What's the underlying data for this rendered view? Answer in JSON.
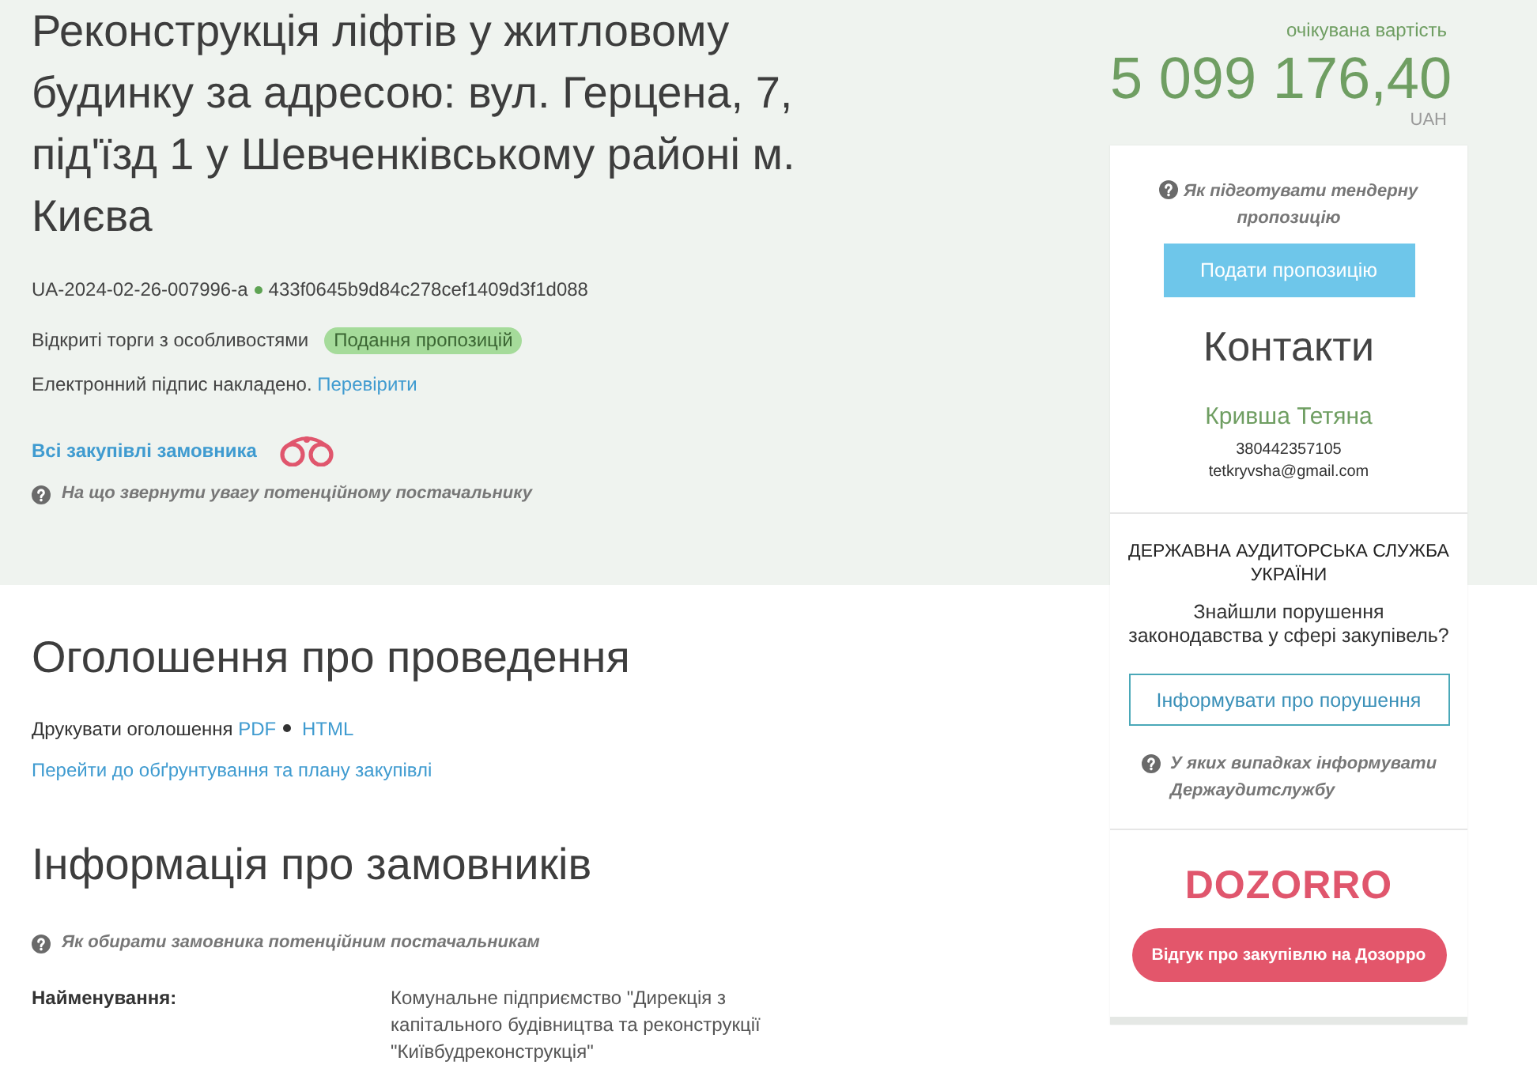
{
  "tender": {
    "title": "Реконструкція ліфтів у житловому будинку за адресою: вул. Герцена, 7, під'їзд 1 у Шевченківському районі м. Києва",
    "id": "UA-2024-02-26-007996-a",
    "hash": "433f0645b9d84c278cef1409d3f1d088",
    "procedure": "Відкриті торги з особливостями",
    "status_badge": "Подання пропозицій",
    "signature_text": "Електронний підпис накладено.",
    "signature_link": "Перевірити",
    "buyer_link": "Всі закупівлі замовника",
    "help_link": "На що звернути увагу потенційному постачальнику"
  },
  "value": {
    "label": "очікувана вартість",
    "amount": "5 099 176,40",
    "currency": "UAH"
  },
  "sidebar": {
    "help_link": "Як підготувати тендерну пропозицію",
    "submit_button": "Подати пропозицію",
    "contacts": {
      "title": "Контакти",
      "name": "Кривша Тетяна",
      "phone": "380442357105",
      "email": "tetkryvsha@gmail.com"
    },
    "audit": {
      "title": "ДЕРЖАВНА АУДИТОРСЬКА СЛУЖБА УКРАЇНИ",
      "question": "Знайшли порушення законодавства у сфері закупівель?",
      "report_button": "Інформувати про порушення",
      "help_link": "У яких випадках інформувати Держаудитслужбу"
    },
    "dozorro": {
      "logo": "DOZORRO",
      "feedback_button": "Відгук про закупівлю на Дозорро"
    }
  },
  "announcement": {
    "title": "Оголошення про проведення",
    "print_label": "Друкувати оголошення",
    "print_links": [
      "PDF",
      "HTML"
    ],
    "plan_link": "Перейти до обґрунтування та плану закупівлі"
  },
  "buyers": {
    "title": "Інформація про замовників",
    "help_link": "Як обирати замовника потенційним постачальникам",
    "fields": [
      {
        "label": "Найменування:",
        "value": "Комунальне підприємство \"Дирекція з капітального будівництва та реконструкції \"Київбудреконструкція\""
      }
    ]
  }
}
